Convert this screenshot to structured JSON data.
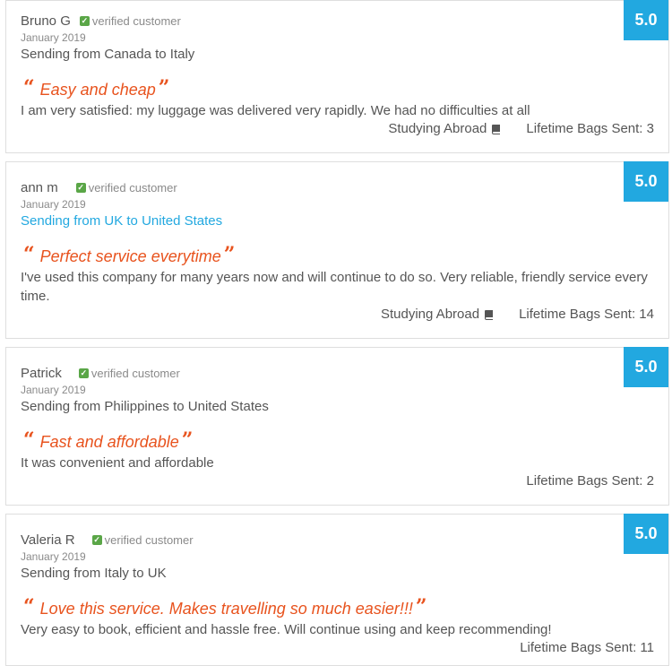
{
  "reviews": [
    {
      "name": "Bruno G",
      "verified": "verified customer",
      "date": "January 2019",
      "route": "Sending from Canada to Italy",
      "title": "Easy and cheap",
      "body": "I am very satisfied: my luggage was delivered very rapidly. We had no difficulties at all",
      "tag": "Studying Abroad",
      "bags": "Lifetime Bags Sent: 3",
      "score": "5.0"
    },
    {
      "name": "ann m",
      "verified": "verified customer",
      "date": "January 2019",
      "route": "Sending from UK to United States",
      "title": "Perfect service everytime",
      "body": "I've used this company for many years now and will continue to do so. Very reliable, friendly service every time.",
      "tag": "Studying Abroad",
      "bags": "Lifetime Bags Sent: 14",
      "score": "5.0"
    },
    {
      "name": "Patrick",
      "verified": "verified customer",
      "date": "January 2019",
      "route": "Sending from Philippines to United States",
      "title": "Fast and affordable",
      "body": "It was convenient and affordable",
      "bags": "Lifetime Bags Sent: 2",
      "score": "5.0"
    },
    {
      "name": "Valeria R",
      "verified": "verified customer",
      "date": "January 2019",
      "route": "Sending from Italy to UK",
      "title": "Love this service. Makes travelling so much easier!!!",
      "body": "Very easy to book, efficient and hassle free. Will continue using and keep recommending!",
      "bags": "Lifetime Bags Sent: 11",
      "score": "5.0"
    }
  ],
  "icons": {
    "verified": "check-icon",
    "quote_open": "quote-open-icon",
    "quote_close": "quote-close-icon",
    "tag": "book-icon"
  },
  "colors": {
    "accent": "#e8531e",
    "score_bg": "#22a8e0",
    "verified": "#5aa647",
    "link": "#22a8e0"
  }
}
